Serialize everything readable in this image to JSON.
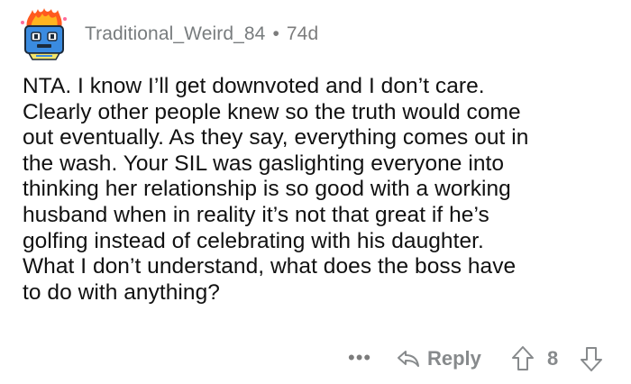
{
  "comment": {
    "author": "Traditional_Weird_84",
    "separator": "•",
    "age": "74d",
    "avatar_icon": "fire-avatar-icon",
    "body_lines": [
      "NTA. I know I’ll get downvoted and I don’t care.",
      "Clearly other people knew so the truth would come",
      "out eventually. As they say, everything comes out in",
      "the wash. Your SIL was gaslighting everyone into",
      "thinking her relationship is so good with a working",
      "husband when in reality it’s not that great if he’s",
      "golfing instead of celebrating with his daughter.",
      "What I don’t understand, what does the boss have",
      "to do with anything?"
    ]
  },
  "actions": {
    "more_label": "•••",
    "reply_label": "Reply",
    "score": "8",
    "icons": [
      "more-icon",
      "reply-arrow-icon",
      "upvote-icon",
      "downvote-icon"
    ]
  }
}
